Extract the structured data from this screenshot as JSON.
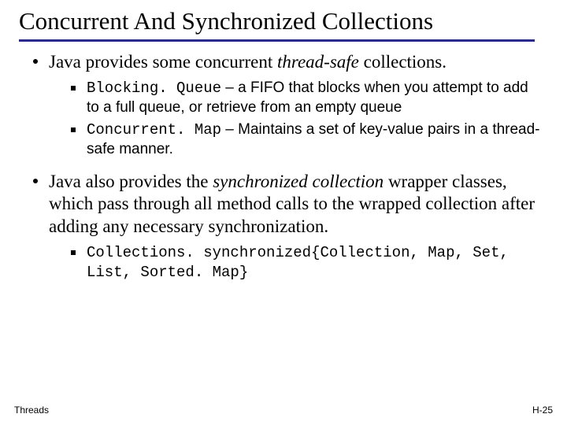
{
  "title": "Concurrent And Synchronized Collections",
  "bullets": [
    {
      "lead": "Java provides some concurrent ",
      "emph": "thread-safe",
      "tail": " collections.",
      "subs": [
        {
          "code": "Blocking. Queue",
          "desc": " – a FIFO that blocks when you attempt to add to a full queue, or retrieve from an empty queue"
        },
        {
          "code": "Concurrent. Map",
          "desc": " – Maintains a set of key-value pairs in a thread-safe manner."
        }
      ]
    },
    {
      "lead": "Java also provides the ",
      "emph": "synchronized collection",
      "tail": " wrapper classes, which pass through all method calls to the wrapped collection after adding any necessary synchronization.",
      "subs": [
        {
          "code": "Collections. synchronized{Collection, Map, Set, List, Sorted. Map}",
          "desc": ""
        }
      ]
    }
  ],
  "footer": {
    "left": "Threads",
    "right": "H-25"
  }
}
